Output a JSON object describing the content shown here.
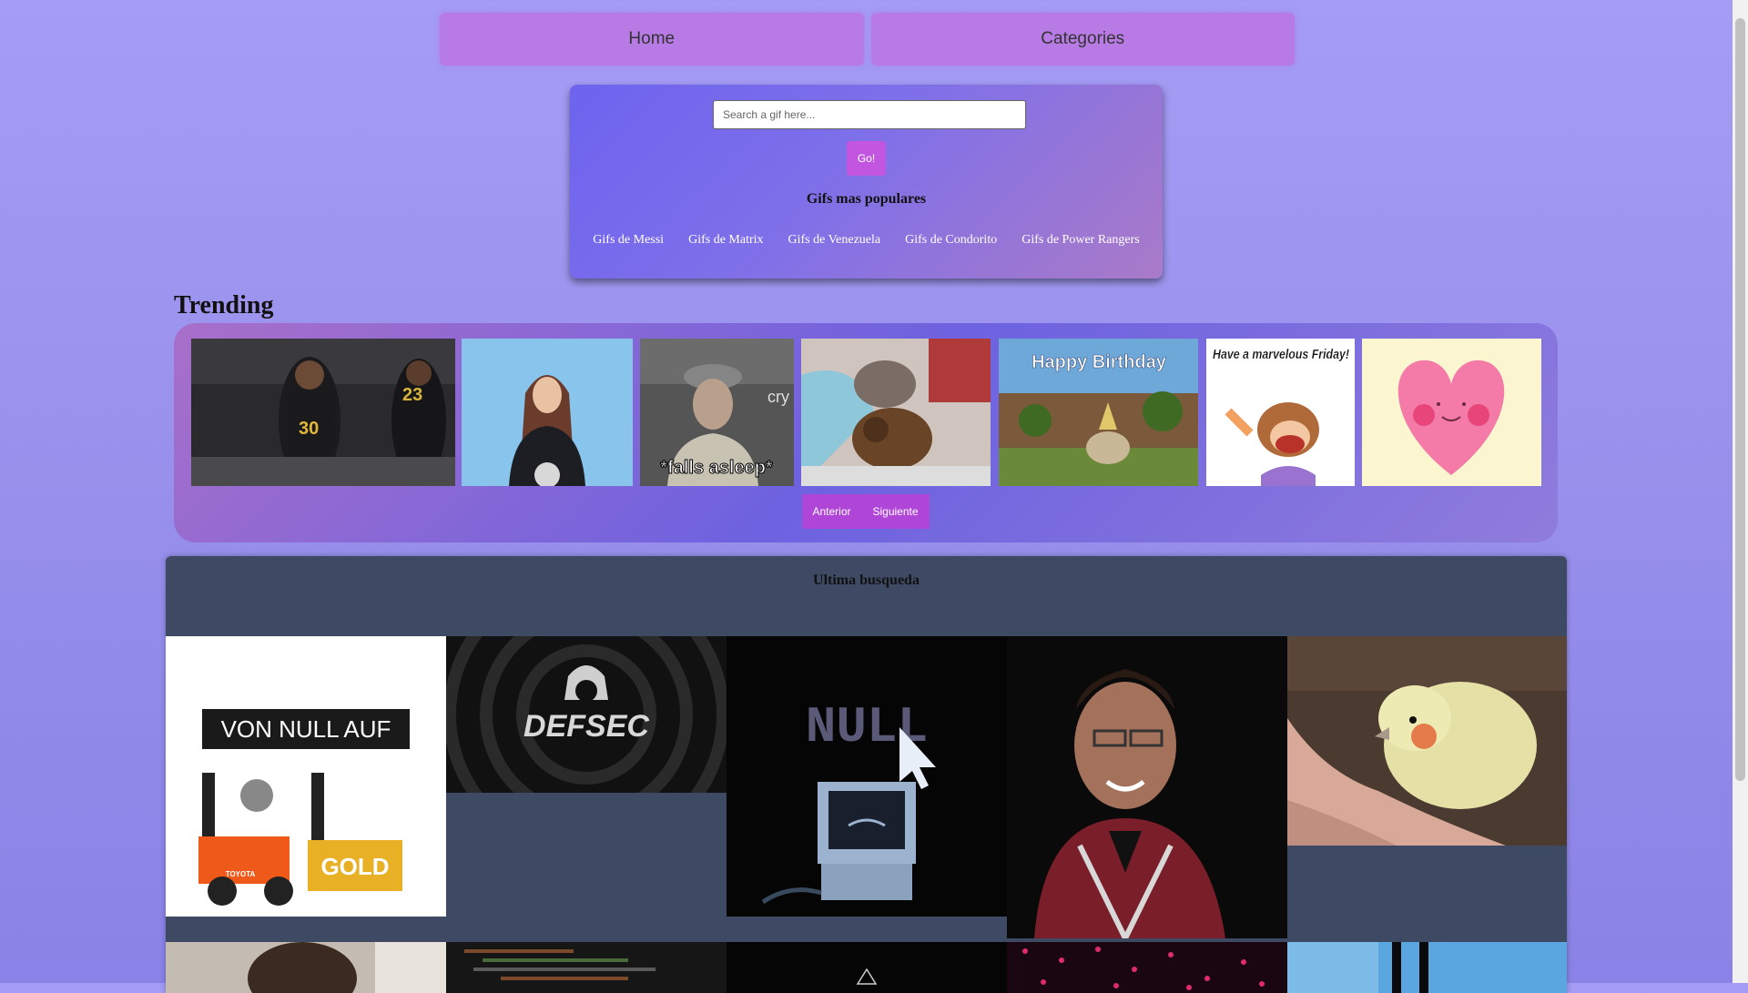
{
  "nav": {
    "home": "Home",
    "categories": "Categories"
  },
  "search": {
    "placeholder": "Search a gif here...",
    "go": "Go!"
  },
  "popular": {
    "title": "Gifs mas populares",
    "links": [
      "Gifs de Messi",
      "Gifs de Matrix",
      "Gifs de Venezuela",
      "Gifs de Condorito",
      "Gifs de Power Rangers"
    ]
  },
  "trending": {
    "title": "Trending",
    "items": [
      {
        "name": "basketball-gif",
        "text": "23"
      },
      {
        "name": "woman-blue-gif",
        "text": ""
      },
      {
        "name": "falls-asleep-gif",
        "text": "*falls asleep*",
        "text2": "cry"
      },
      {
        "name": "kitten-bear-gif",
        "text": ""
      },
      {
        "name": "happy-birthday-gif",
        "text": "Happy Birthday"
      },
      {
        "name": "marvelous-friday-gif",
        "text": "Have a marvelous Friday!"
      },
      {
        "name": "pink-heart-gif",
        "text": ""
      }
    ],
    "prev": "Anterior",
    "next": "Siguiente"
  },
  "last_search": {
    "title": "Ultima busqueda",
    "items": [
      {
        "name": "von-null-auf-gold-gif",
        "top": "VON NULL AUF",
        "bottom": "GOLD",
        "brand": "TOYOTA"
      },
      {
        "name": "defsec-logo-gif",
        "text": "DEFSEC"
      },
      {
        "name": "null-computer-gif",
        "text": "NULL"
      },
      {
        "name": "laughing-man-gif",
        "text": ""
      },
      {
        "name": "cockatiel-gif",
        "text": ""
      }
    ]
  }
}
